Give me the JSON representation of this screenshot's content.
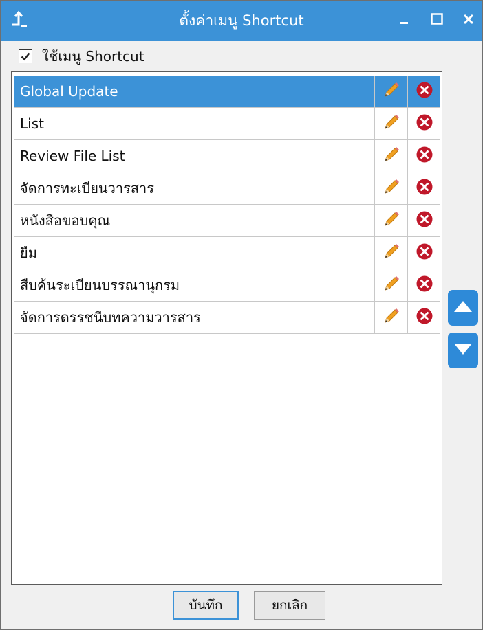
{
  "window": {
    "title": "ตั้งค่าเมนู Shortcut",
    "icons": {
      "app": "shortcut-arrow-icon",
      "minimize": "minimize-icon",
      "maximize": "maximize-icon",
      "close": "close-icon"
    },
    "accent_color": "#3c92d7"
  },
  "enable_shortcut": {
    "label": "ใช้เมนู Shortcut",
    "checked": true
  },
  "menu_items": [
    {
      "label": "Global Update",
      "selected": true
    },
    {
      "label": "List",
      "selected": false
    },
    {
      "label": "Review File List",
      "selected": false
    },
    {
      "label": "จัดการทะเบียนวารสาร",
      "selected": false
    },
    {
      "label": "หนังสือขอบคุณ",
      "selected": false
    },
    {
      "label": "ยืม",
      "selected": false
    },
    {
      "label": "สืบค้นระเบียนบรรณานุกรม",
      "selected": false
    },
    {
      "label": "จัดการดรรชนีบทความวารสาร",
      "selected": false
    }
  ],
  "row_icons": {
    "edit": "pencil-icon",
    "delete": "delete-x-icon"
  },
  "side_buttons": {
    "up": "arrow-up-icon",
    "down": "arrow-down-icon"
  },
  "buttons": {
    "save": "บันทึก",
    "cancel": "ยกเลิก"
  }
}
